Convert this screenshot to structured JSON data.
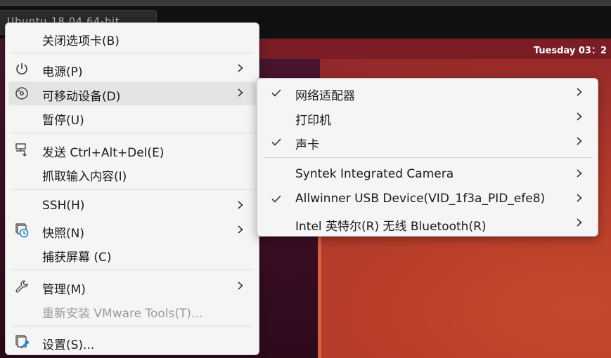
{
  "vm_tab": {
    "title": "Ubuntu 18.04 64-bit"
  },
  "panel": {
    "clock": "Tuesday 03：2"
  },
  "main_menu": {
    "items": [
      {
        "label": "关闭选项卡(B)"
      },
      {
        "label": "电源(P)"
      },
      {
        "label": "可移动设备(D)"
      },
      {
        "label": "暂停(U)"
      },
      {
        "label": "发送 Ctrl+Alt+Del(E)"
      },
      {
        "label": "抓取输入内容(I)"
      },
      {
        "label": "SSH(H)"
      },
      {
        "label": "快照(N)"
      },
      {
        "label": "捕获屏幕 (C)"
      },
      {
        "label": "管理(M)"
      },
      {
        "label": "重新安装 VMware Tools(T)..."
      },
      {
        "label": "设置(S)..."
      }
    ]
  },
  "devices_submenu": {
    "items": [
      {
        "label": "网络适配器"
      },
      {
        "label": "打印机"
      },
      {
        "label": "声卡"
      },
      {
        "label": "Syntek Integrated Camera"
      },
      {
        "label": "Allwinner USB Device(VID_1f3a_PID_efe8)"
      },
      {
        "label": "Intel 英特尔(R) 无线 Bluetooth(R)"
      }
    ]
  },
  "colors": {
    "menu_bg": "#f5f5f5",
    "hover_bg": "#e4e4e4",
    "accent_blue": "#1e88d8",
    "disabled_text": "#9a9a9a"
  }
}
